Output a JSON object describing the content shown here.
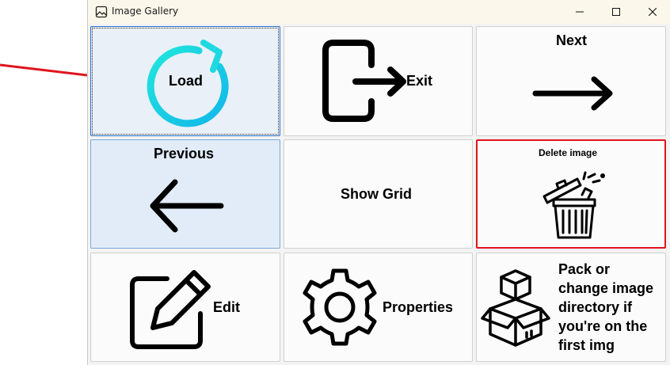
{
  "window": {
    "title": "Image Gallery"
  },
  "tiles": {
    "load": {
      "label": "Load",
      "icon": "reload-icon"
    },
    "exit": {
      "label": "Exit",
      "icon": "exit-icon"
    },
    "next": {
      "label": "Next",
      "icon": "arrow-right-icon"
    },
    "previous": {
      "label": "Previous",
      "icon": "arrow-left-icon"
    },
    "show_grid": {
      "label": "Show Grid"
    },
    "delete": {
      "label": "Delete image",
      "icon": "trash-icon"
    },
    "edit": {
      "label": "Edit",
      "icon": "pencil-icon"
    },
    "properties": {
      "label": "Properties",
      "icon": "gear-icon"
    },
    "pack": {
      "line1": "Pack or",
      "line2": "change image",
      "line3": "directory if",
      "line4": "you're on the",
      "line5": "first img",
      "icon": "boxes-icon"
    }
  },
  "colors": {
    "accent": "#19c7e6",
    "highlight_border": "#e0141c",
    "annotation_arrow": "#e0141c"
  }
}
